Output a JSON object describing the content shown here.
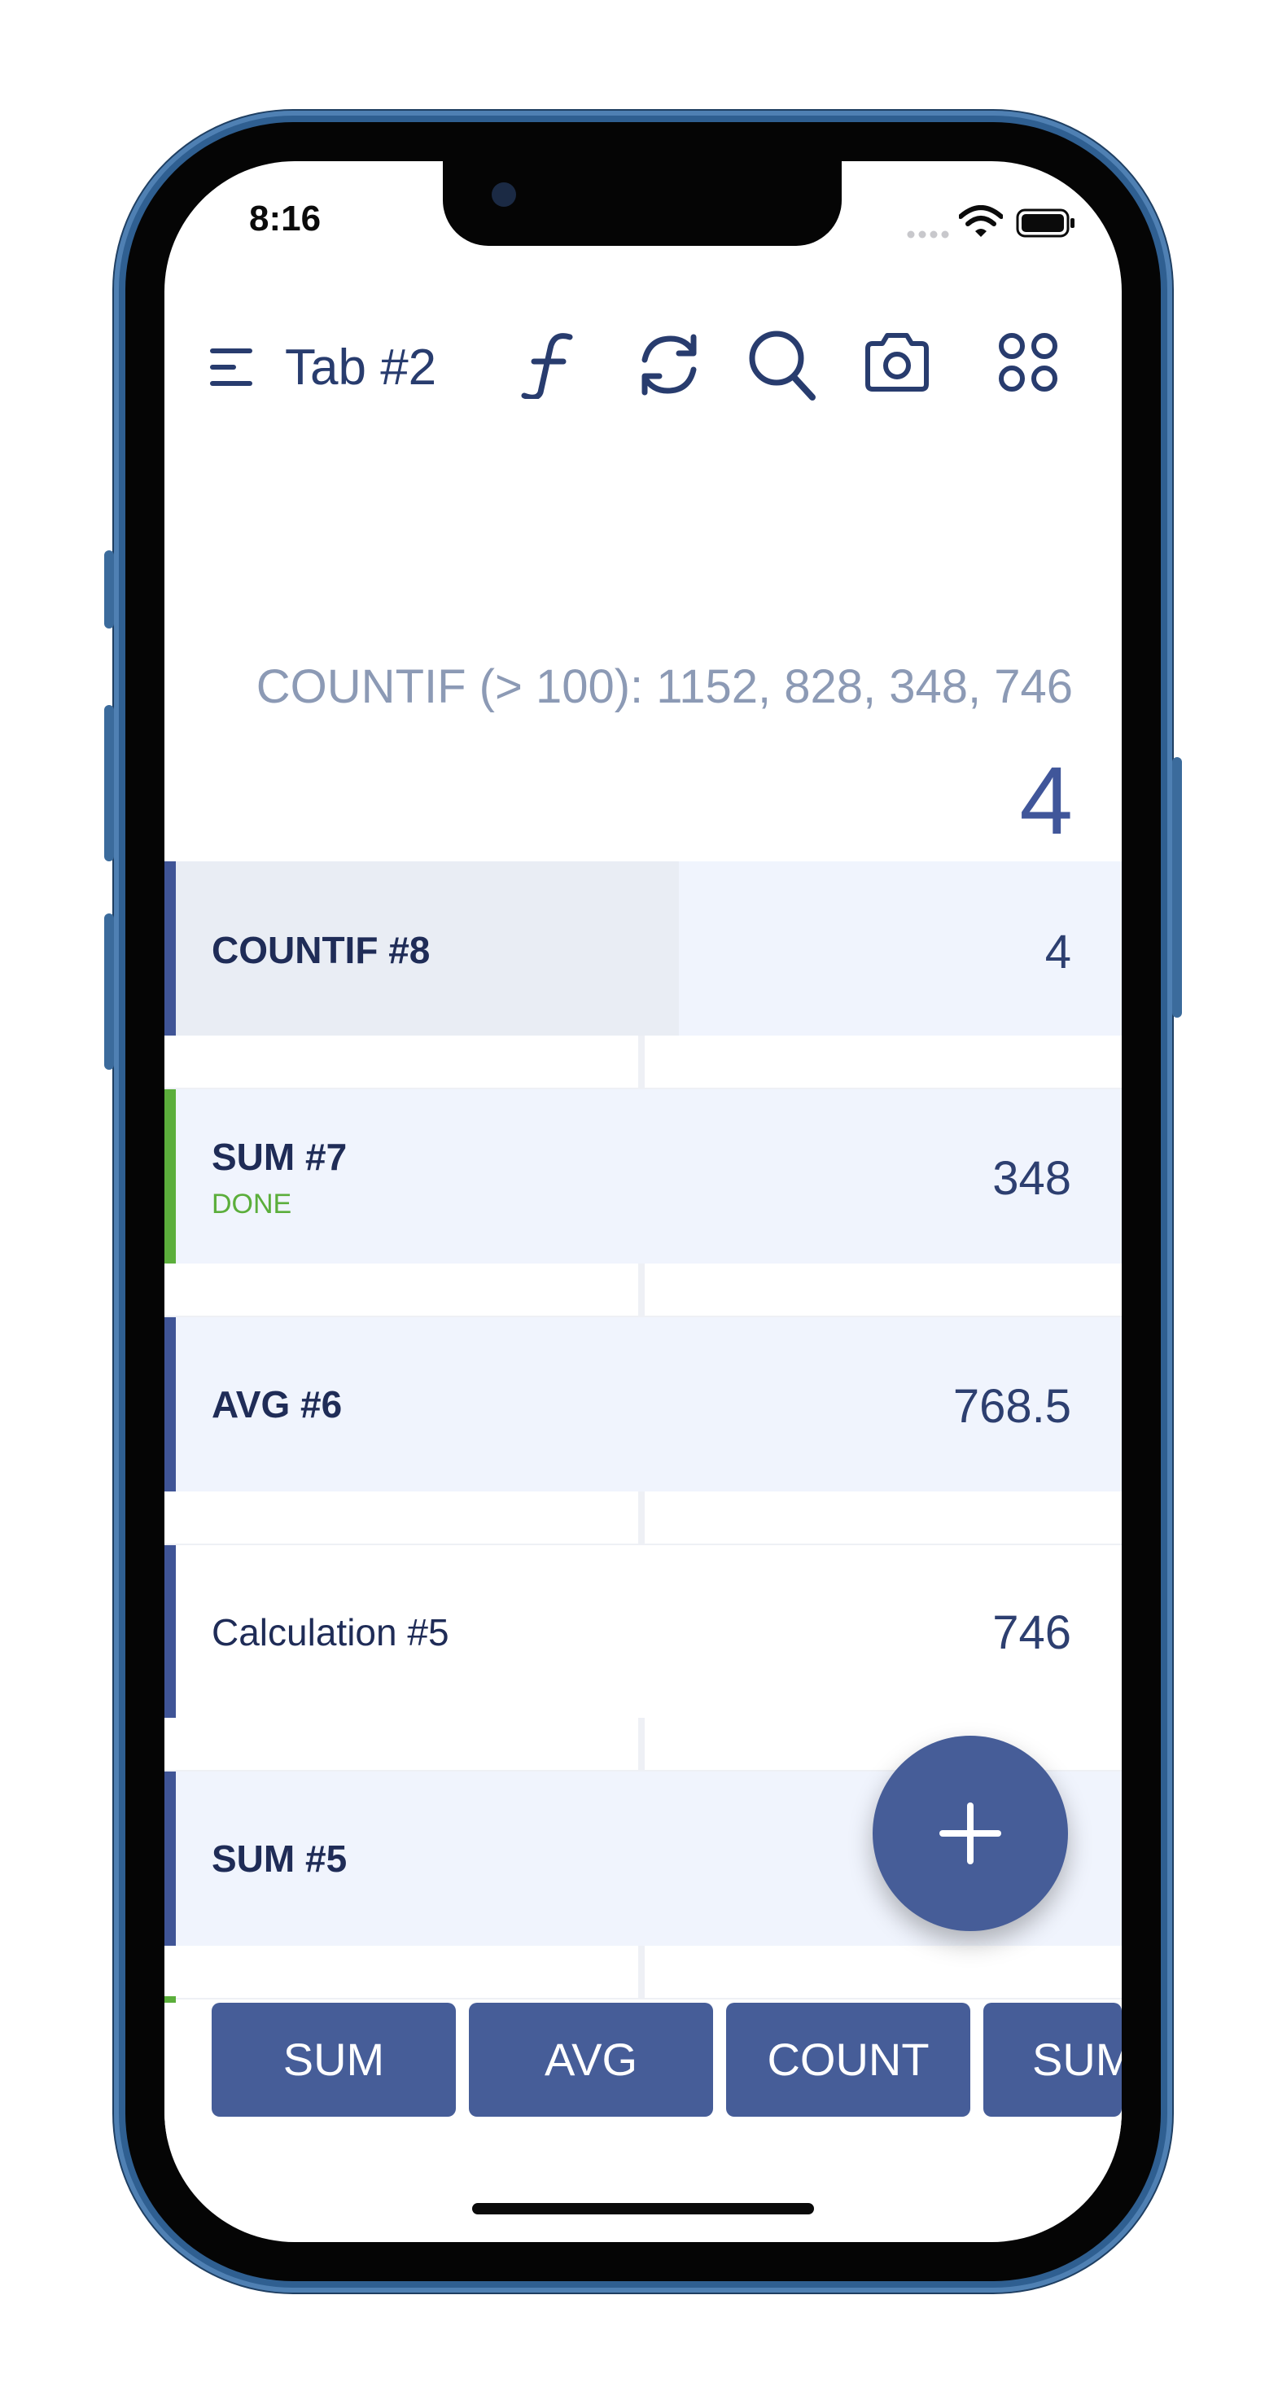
{
  "status_bar": {
    "time": "8:16"
  },
  "toolbar": {
    "tab_title": "Tab #2",
    "icons": [
      "menu-icon",
      "function-icon",
      "refresh-icon",
      "search-icon",
      "camera-icon",
      "grid-icon"
    ]
  },
  "display": {
    "expression": "COUNTIF (> 100): 1152, 828, 348, 746",
    "result": "4"
  },
  "rows": [
    {
      "label": "COUNTIF #8",
      "value": "4",
      "sub": "",
      "bar_color": "#3f5496",
      "bold": true
    },
    {
      "label": "SUM #7",
      "value": "348",
      "sub": "DONE",
      "bar_color": "#5bae3b",
      "bold": true
    },
    {
      "label": "AVG #6",
      "value": "768.5",
      "sub": "",
      "bar_color": "#3f5496",
      "bold": true
    },
    {
      "label": "Calculation #5",
      "value": "746",
      "sub": "",
      "bar_color": "#3f5496",
      "bold": false
    },
    {
      "label": "SUM #5",
      "value": "",
      "sub": "",
      "bar_color": "#3f5496",
      "bold": true
    }
  ],
  "quick_buttons": [
    "SUM",
    "AVG",
    "COUNT",
    "SUM"
  ],
  "colors": {
    "accent": "#465d98",
    "done_green": "#5bae3b",
    "row_tint": "#f0f4fd",
    "row_selected_left": "#e9edf4"
  }
}
